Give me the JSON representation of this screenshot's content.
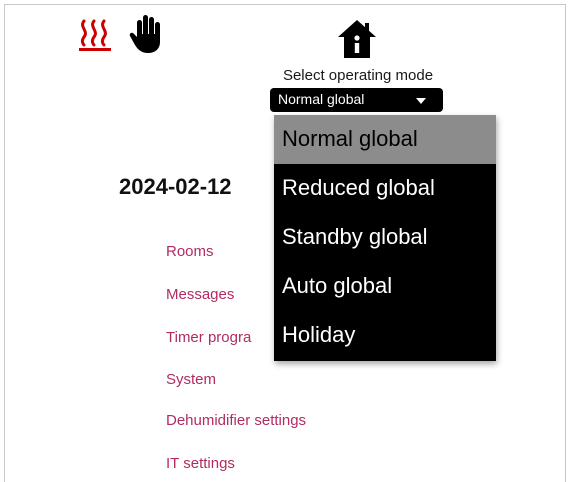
{
  "header": {
    "heat_icon": "heating-wavy-lines-icon",
    "manual_icon": "hand-icon",
    "home_icon": "house-info-icon",
    "accent_color": "#cc0000"
  },
  "mode": {
    "label": "Select operating mode",
    "selected": "Normal global",
    "options": [
      "Normal global",
      "Reduced global",
      "Standby global",
      "Auto global",
      "Holiday"
    ]
  },
  "date_text": "2024-02-12",
  "nav": {
    "link_color": "#b02c63",
    "items": [
      "Rooms",
      "Messages",
      "Timer progra",
      "System",
      "Dehumidifier settings",
      "IT settings"
    ]
  }
}
